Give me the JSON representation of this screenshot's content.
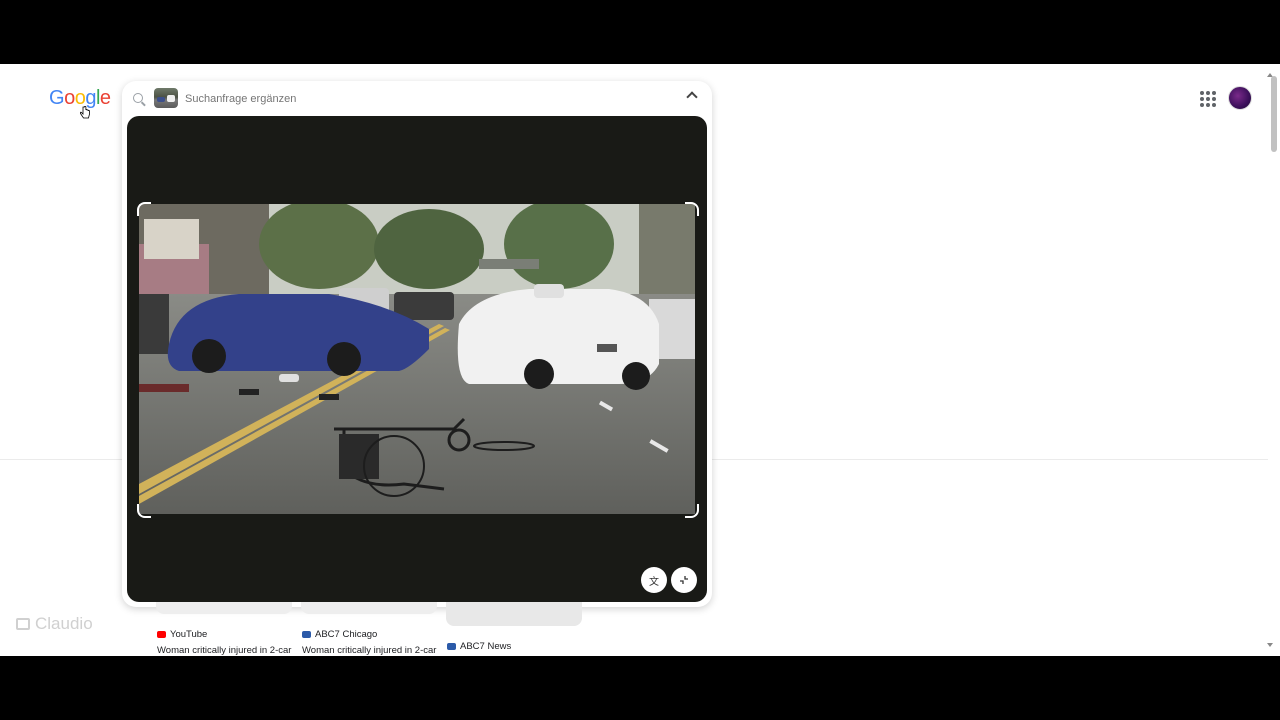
{
  "logo": {
    "letters": [
      "G",
      "o",
      "o",
      "g",
      "l",
      "e"
    ],
    "colors": [
      "#4285F4",
      "#EA4335",
      "#FBBC05",
      "#4285F4",
      "#34A853",
      "#EA4335"
    ]
  },
  "search": {
    "placeholder": "Suchanfrage ergänzen"
  },
  "icons": {
    "search": "search-icon",
    "collapse": "chevron-up-icon",
    "apps": "apps-grid-icon",
    "translate": "translate-icon",
    "exit_fullscreen": "collapse-icon"
  },
  "results": [
    {
      "source": "YouTube",
      "source_color": "#FF0000",
      "title": "Woman critically injured in 2-car"
    },
    {
      "source": "ABC7 Chicago",
      "source_color": "#2b5aa8",
      "title": "Woman critically injured in 2-car"
    },
    {
      "source": "ABC7 News",
      "source_color": "#2b5aa8",
      "title": ""
    }
  ],
  "watermark": {
    "text": "Claudio"
  }
}
